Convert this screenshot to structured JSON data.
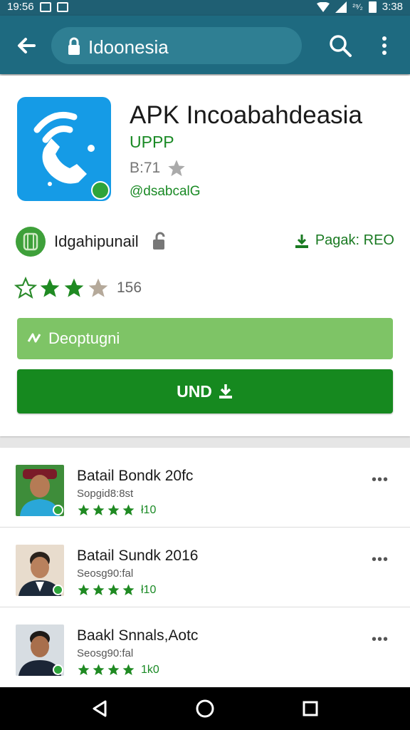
{
  "status_bar": {
    "time_left": "19:56",
    "signal": "²⁹⁄₂",
    "time_right": "3:38"
  },
  "app_bar": {
    "back_icon": "arrow-left-icon",
    "url_text": "Idoonesia",
    "search_icon": "search-icon",
    "menu_icon": "more-vert-icon"
  },
  "app": {
    "title": "APK Incoabahdeasia",
    "subtitle": "UPPP",
    "size": "B:71",
    "developer_handle": "@dsabcalG",
    "developer_name": "Idgahipunail",
    "package_link": "Pagak: REO",
    "rating_count": "156",
    "rating_stars": 3,
    "secondary_button": "Deoptugni",
    "primary_button": "UND"
  },
  "list": [
    {
      "title": "Batail Bondk 20fc",
      "subtitle": "Sopgid8:8st",
      "rating_count": "ł10",
      "stars": 4
    },
    {
      "title": "Batail Sundk 2016",
      "subtitle": "Seosg90:fal",
      "rating_count": "ł10",
      "stars": 4
    },
    {
      "title": "Baakl Snnals,Aotc",
      "subtitle": "Seosg90:fal",
      "rating_count": "1k0",
      "stars": 4
    }
  ],
  "colors": {
    "accent_green": "#16891f",
    "app_bar": "#1e6a80",
    "app_icon": "#159be6"
  }
}
